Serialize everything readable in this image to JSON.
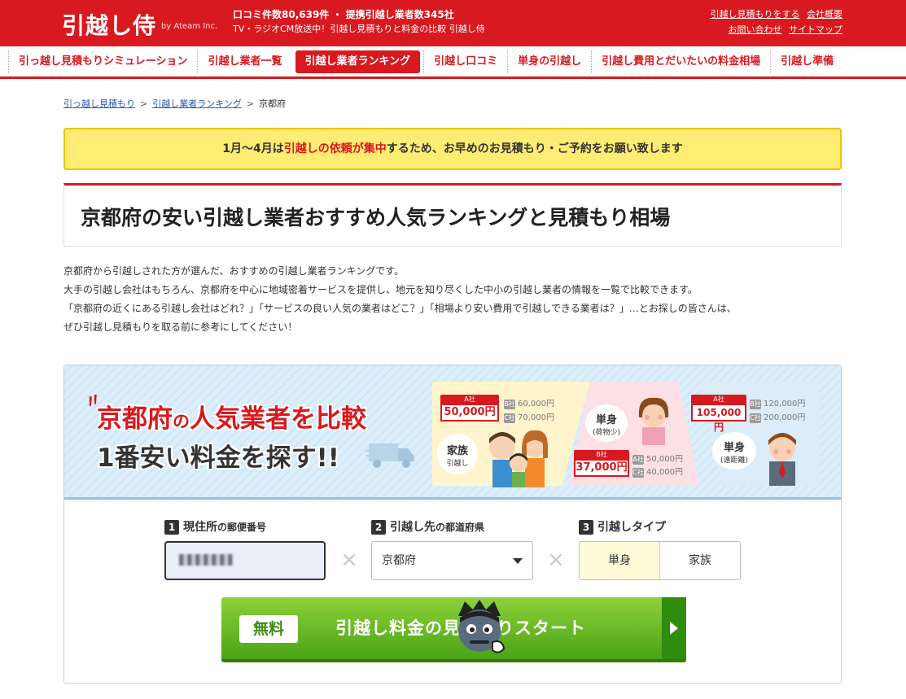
{
  "header": {
    "logo": "引越し侍",
    "logo_by": "by Ateam Inc.",
    "info_line1": "口コミ件数80,639件 ・ 提携引越し業者数345社",
    "info_line2": "TV・ラジオCM放送中！引越し見積もりと料金の比較 引越し侍",
    "links_row1": [
      "引越し見積もりをする",
      "会社概要"
    ],
    "links_row2": [
      "お問い合わせ",
      "サイトマップ"
    ]
  },
  "nav": {
    "items": [
      {
        "label": "引っ越し見積もりシミュレーション"
      },
      {
        "label": "引越し業者一覧"
      },
      {
        "label": "引越し業者ランキング"
      },
      {
        "label": "引越し口コミ"
      },
      {
        "label": "単身の引越し"
      },
      {
        "label": "引越し費用とだいたいの料金相場"
      },
      {
        "label": "引越し準備"
      }
    ]
  },
  "breadcrumb": {
    "items": [
      "引っ越し見積もり",
      "引越し業者ランキング",
      "京都府"
    ],
    "sep": ">"
  },
  "notice": {
    "pre": "1月〜4月は",
    "highlight": "引越しの依頼が集中",
    "post": "するため、お早めのお見積もり・ご予約をお願い致します"
  },
  "title": "京都府の安い引越し業者おすすめ人気ランキングと見積もり相場",
  "intro": [
    "京都府から引越しされた方が選んだ、おすすめの引越し業者ランキングです。",
    "大手の引越し会社はもちろん、京都府を中心に地域密着サービスを提供し、地元を知り尽くした中小の引越し業者の情報を一覧で比較できます。",
    "「京都府の近くにある引越し会社はどれ？」「サービスの良い人気の業者はどこ？」「相場より安い費用で引越しできる業者は？」…とお探しの皆さんは、",
    "ぜひ引越し見積もりを取る前に参考にしてください！"
  ],
  "banner": {
    "h1_pref": "京都府",
    "h1_mid": "の",
    "h1_rest": "人気業者を比較",
    "h2": "1番安い料金を探す!!",
    "card1": {
      "tag": "A社",
      "price": "50,000円",
      "b_key": "B社",
      "b_price": "60,000円",
      "c_key": "C社",
      "c_price": "70,000円",
      "bubble_main": "家族",
      "bubble_sub": "引越し"
    },
    "card2": {
      "bubble_main": "単身",
      "bubble_sub": "(荷物少)",
      "tag": "B社",
      "price": "37,000円",
      "a_key": "A社",
      "a_price": "50,000円",
      "c_key": "C社",
      "c_price": "40,000円"
    },
    "card3": {
      "tag": "A社",
      "price": "105,000円",
      "b_key": "B社",
      "b_price": "120,000円",
      "c_key": "C社",
      "c_price": "200,000円",
      "bubble_main": "単身",
      "bubble_sub": "(遠距離)"
    }
  },
  "form": {
    "step1": {
      "num": "1",
      "label_a": "現住所",
      "label_b": "の郵便番号"
    },
    "step2": {
      "num": "2",
      "label_a": "引越し先",
      "label_b": "の都道府県"
    },
    "step3": {
      "num": "3",
      "label_a": "引越しタイプ"
    },
    "times": "×",
    "prefecture": "京都府",
    "type_options": [
      "単身",
      "家族"
    ],
    "cta_free": "無料",
    "cta_label": "引越し料金の見積もりスタート"
  },
  "colors": {
    "brand": "#d8191f",
    "cta": "#5cb51f",
    "notice": "#ffec73"
  }
}
